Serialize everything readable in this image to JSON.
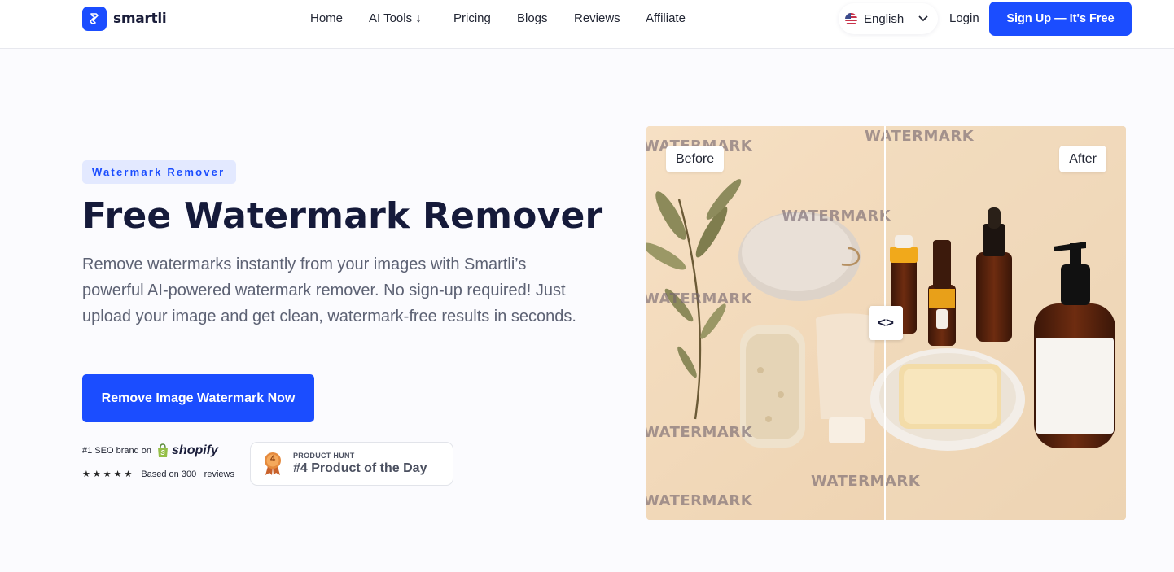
{
  "header": {
    "brand": "smartli",
    "nav": [
      {
        "label": "Home"
      },
      {
        "label": "AI Tools ↓"
      },
      {
        "label": "Pricing"
      },
      {
        "label": "Blogs"
      },
      {
        "label": "Reviews"
      },
      {
        "label": "Affiliate"
      }
    ],
    "language": "English",
    "login_label": "Login",
    "signup_label": "Sign Up — It's Free"
  },
  "hero": {
    "badge": "Watermark Remover",
    "title": "Free Watermark Remover",
    "description": "Remove watermarks instantly from your images with Smartli’s powerful AI-powered watermark remover. No sign-up required! Just upload your image and get clean, watermark-free results in seconds.",
    "cta_label": "Remove Image Watermark Now",
    "shopify": {
      "prefix": "#1 SEO brand on",
      "brand": "shopify",
      "stars": "★★★★★",
      "reviews": "Based on 300+ reviews"
    },
    "product_hunt": {
      "medal": "4",
      "top": "PRODUCT HUNT",
      "main": "#4 Product of the Day"
    }
  },
  "compare": {
    "before_label": "Before",
    "after_label": "After",
    "watermark_text": "WATERMARK",
    "handle_icon": "<>",
    "split_fraction": 0.5
  },
  "colors": {
    "accent": "#1b4dff",
    "title": "#151a3a",
    "body_text": "#5d6274",
    "badge_bg": "#e3e9ff"
  }
}
